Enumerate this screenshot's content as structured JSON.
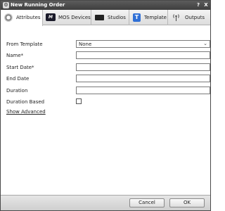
{
  "window": {
    "title": "New Running Order",
    "help_label": "?",
    "close_label": "X",
    "app_icon": "gear-icon"
  },
  "tabs": [
    {
      "label": "Attributes",
      "icon": "gear-icon",
      "active": true
    },
    {
      "label": "MOS Devices",
      "icon": "mos-icon",
      "active": false
    },
    {
      "label": "Studios",
      "icon": "camera-icon",
      "active": false
    },
    {
      "label": "Template",
      "icon": "template-icon",
      "active": false
    },
    {
      "label": "Outputs",
      "icon": "antenna-icon",
      "active": false
    }
  ],
  "form": {
    "from_template": {
      "label": "From Template",
      "value": "None"
    },
    "name": {
      "label": "Name*",
      "value": ""
    },
    "start_date": {
      "label": "Start Date*",
      "value": ""
    },
    "end_date": {
      "label": "End Date",
      "value": ""
    },
    "duration": {
      "label": "Duration",
      "value": ""
    },
    "duration_based": {
      "label": "Duration Based",
      "checked": false
    },
    "show_advanced": "Show Advanced"
  },
  "footer": {
    "cancel_label": "Cancel",
    "ok_label": "OK"
  },
  "glyphs": {
    "mos": "M",
    "template": "T",
    "outputs": "((o))",
    "chevron": "⌄"
  }
}
